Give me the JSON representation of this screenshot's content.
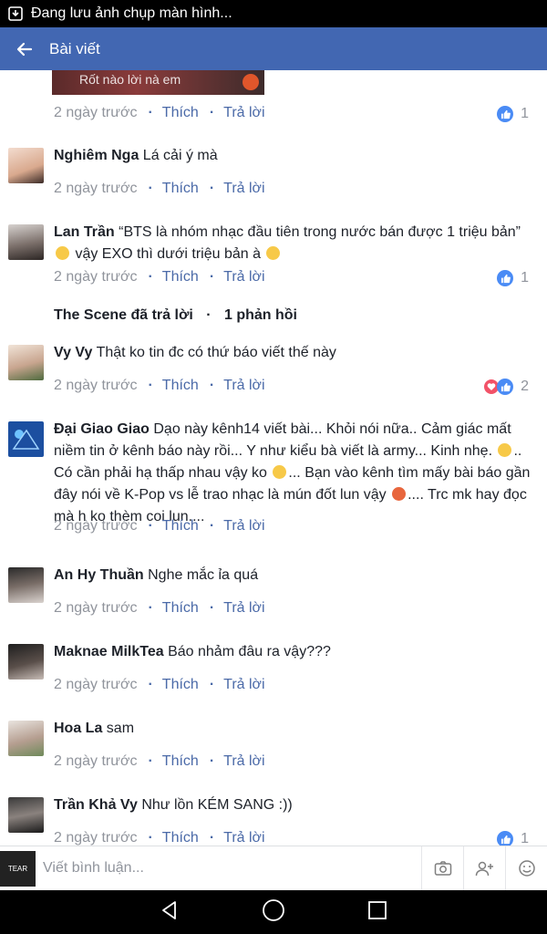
{
  "status_bar": {
    "text": "Đang lưu ảnh chụp màn hình..."
  },
  "app_bar": {
    "title": "Bài viết"
  },
  "top_thumb": {
    "text": "Rốt nào lời nà em"
  },
  "labels": {
    "time": "2 ngày trước",
    "like": "Thích",
    "reply": "Trả lời"
  },
  "comments": [
    {
      "author": "",
      "text": "",
      "likes": "1"
    },
    {
      "author": "Nghiêm Nga",
      "text": "Lá cải ý mà",
      "likes": ""
    },
    {
      "author": "Lan Trần",
      "text": "“BTS là nhóm nhạc đầu tiên trong nước bán được 1 triệu bản”",
      "text2": "vậy EXO thì dưới triệu bản à",
      "likes": "1"
    },
    {
      "author": "Vy Vy",
      "text": "Thật ko tin đc có thứ báo viết thế này",
      "likes": "2"
    },
    {
      "author": "Đại Giao Giao",
      "text": "Dạo này kênh14 viết bài...  Khỏi nói nữa.. Cảm giác mất niềm tin ở kênh báo này rồi... Y như kiểu bà viết là army...  Kinh nhẹ.",
      "text2": "..  Có cần phải hạ thấp nhau vậy ko",
      "text3": "... Bạn vào kênh tìm mấy bài báo gần đây nói về K-Pop vs lễ trao nhạc là mún đốt lun vậy",
      "text4": ".... Trc mk hay đọc mà h ko thèm coi lun....",
      "likes": ""
    },
    {
      "author": "An Hy Thuần",
      "text": "Nghe mắc ỉa quá",
      "likes": ""
    },
    {
      "author": "Maknae MilkTea",
      "text": "Báo nhảm đâu ra vậy???",
      "likes": ""
    },
    {
      "author": "Hoa La",
      "text": "sam",
      "likes": ""
    },
    {
      "author": "Trần Khả Vy",
      "text": "Như lồn KÉM SANG :))",
      "likes": "1"
    }
  ],
  "replies_row": {
    "author": "The Scene đã trả lời",
    "count": "1 phản hồi"
  },
  "input": {
    "placeholder": "Viết bình luận..."
  },
  "me_avatar_text": "TEAR",
  "colors": {
    "brand": "#4267b2",
    "link": "#4b6aa8",
    "meta": "#90949c",
    "like": "#4a8bf5",
    "heart": "#f25268"
  },
  "icons": [
    "back-arrow-icon",
    "camera-icon",
    "add-friend-icon",
    "emoji-icon",
    "nav-back-icon",
    "nav-home-icon",
    "nav-recents-icon"
  ]
}
